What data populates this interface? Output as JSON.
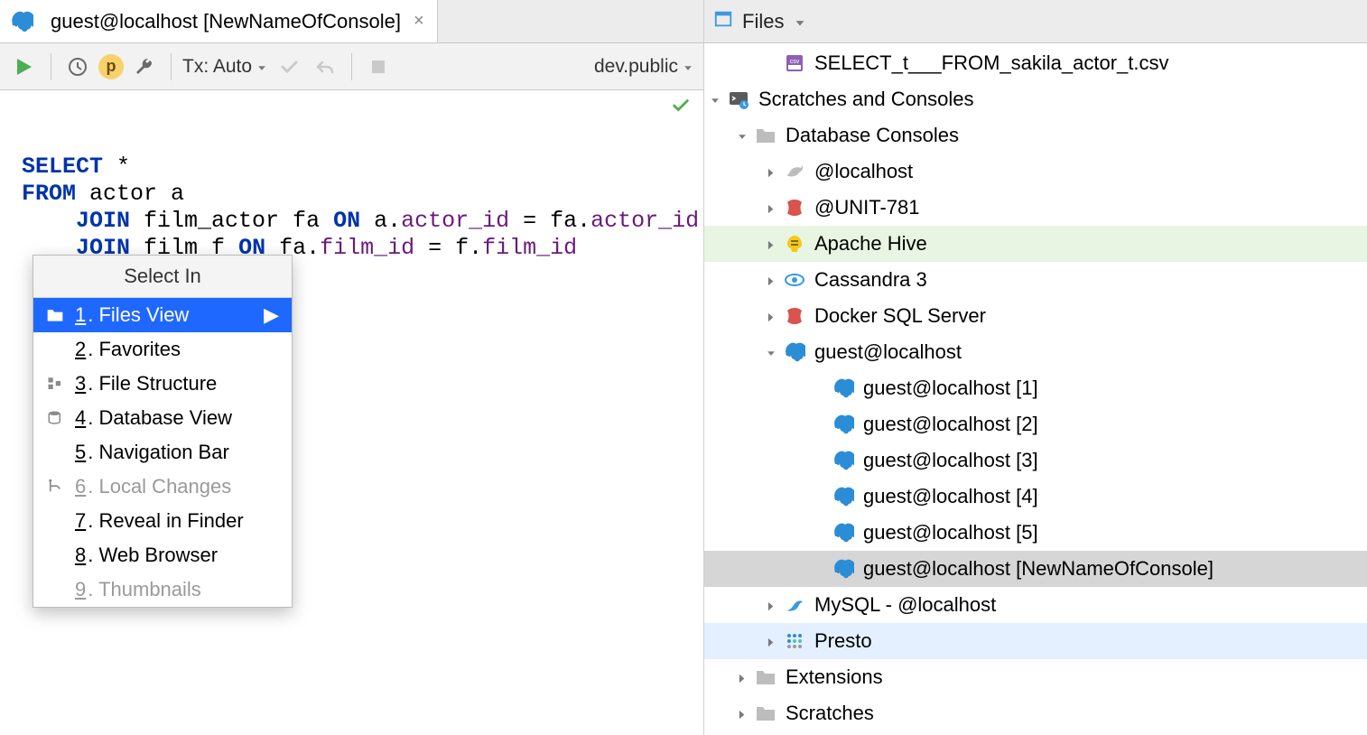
{
  "tab": {
    "title": "guest@localhost [NewNameOfConsole]"
  },
  "toolbar": {
    "tx_label": "Tx: Auto",
    "schema_label": "dev.public"
  },
  "sql": {
    "l1_kw": "SELECT",
    "l1_rest": " *",
    "l2_kw": "FROM",
    "l2_rest": " actor a",
    "l3_pad": "    ",
    "l3_kw": "JOIN",
    "l3_a": " film_actor fa ",
    "l3_on": "ON",
    "l3_b": " a.",
    "l3_id1": "actor_id",
    "l3_eq": " = fa.",
    "l3_id2": "actor_id",
    "l4_pad": "    ",
    "l4_kw": "JOIN",
    "l4_a": " film f ",
    "l4_on": "ON",
    "l4_b": " fa.",
    "l4_id1": "film_id",
    "l4_eq": " = f.",
    "l4_id2": "film_id"
  },
  "popup": {
    "title": "Select In",
    "i1_num": "1",
    "i1_label": ". Files View",
    "i2_num": "2",
    "i2_label": ". Favorites",
    "i3_num": "3",
    "i3_label": ". File Structure",
    "i4_num": "4",
    "i4_label": ". Database View",
    "i5_num": "5",
    "i5_label": ". Navigation Bar",
    "i6_num": "6",
    "i6_label": ". Local Changes",
    "i7_num": "7",
    "i7_label": ". Reveal in Finder",
    "i8_num": "8",
    "i8_label": ". Web Browser",
    "i9_num": "9",
    "i9_label": ". Thumbnails"
  },
  "files_panel": {
    "title": "Files"
  },
  "tree": {
    "csv": "SELECT_t___FROM_sakila_actor_t.csv",
    "scratches": "Scratches and Consoles",
    "db_consoles": "Database Consoles",
    "at_localhost": "@localhost",
    "unit": "@UNIT-781",
    "hive": "Apache Hive",
    "cassandra": "Cassandra 3",
    "docker": "Docker SQL Server",
    "guest": "guest@localhost",
    "g1": "guest@localhost [1]",
    "g2": "guest@localhost [2]",
    "g3": "guest@localhost [3]",
    "g4": "guest@localhost [4]",
    "g5": "guest@localhost [5]",
    "gnew": "guest@localhost [NewNameOfConsole]",
    "mysql": "MySQL - @localhost",
    "presto": "Presto",
    "ext": "Extensions",
    "scr": "Scratches"
  }
}
